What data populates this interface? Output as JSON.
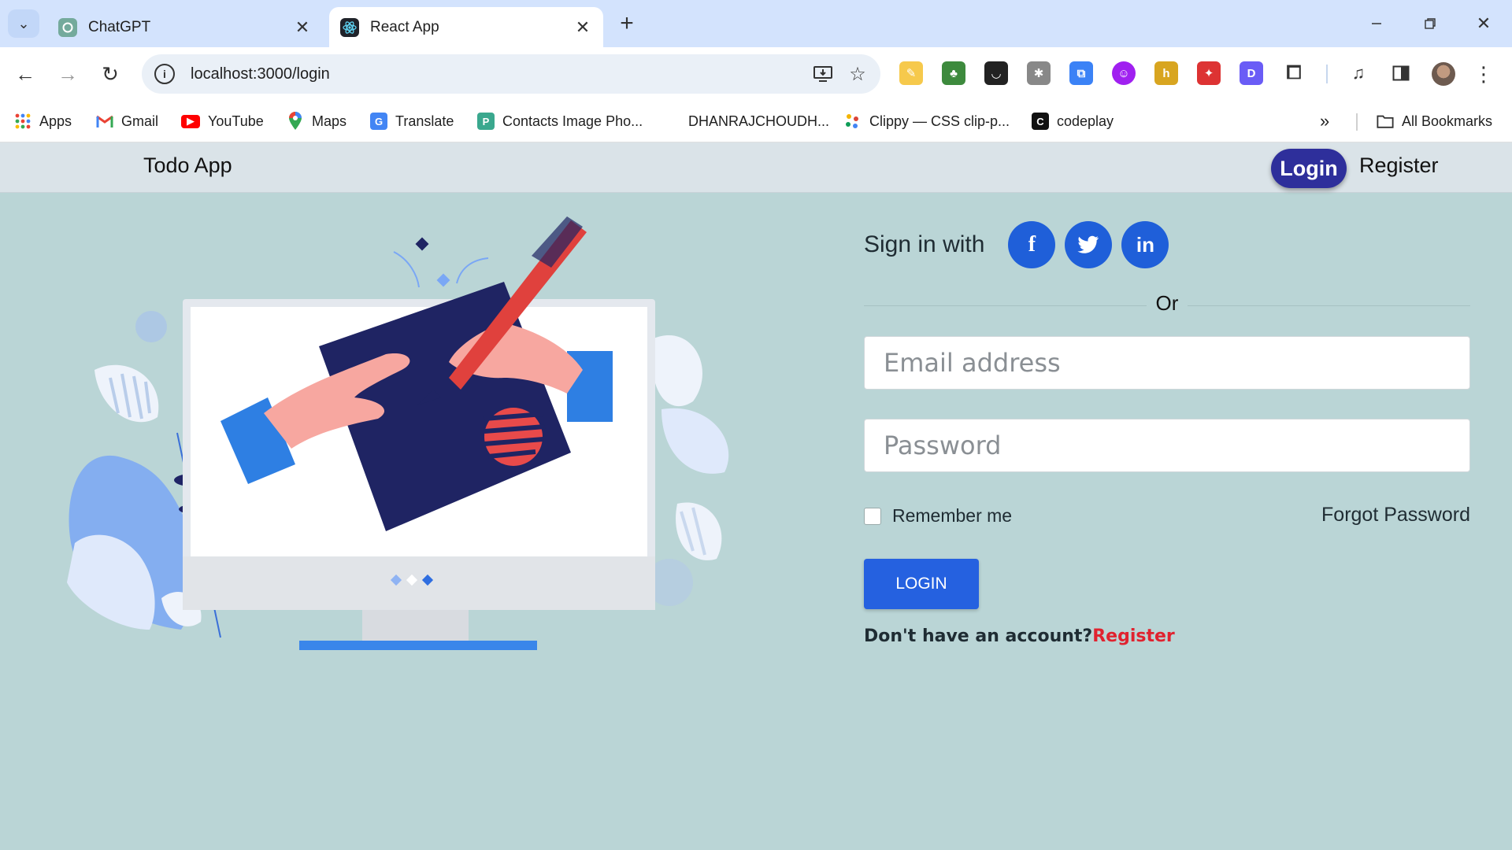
{
  "browser": {
    "tabs": [
      {
        "title": "ChatGPT",
        "active": false
      },
      {
        "title": "React App",
        "active": true
      }
    ],
    "url": "localhost:3000/login",
    "bookmarks": [
      {
        "label": "Apps",
        "icon": "apps-grid-icon"
      },
      {
        "label": "Gmail",
        "icon": "gmail-icon"
      },
      {
        "label": "YouTube",
        "icon": "youtube-icon"
      },
      {
        "label": "Maps",
        "icon": "maps-icon"
      },
      {
        "label": "Translate",
        "icon": "translate-icon"
      },
      {
        "label": "Contacts Image Pho...",
        "icon": "contacts-image-icon"
      },
      {
        "label": "DHANRAJCHOUDH...",
        "icon": "none"
      },
      {
        "label": "Clippy — CSS clip-p...",
        "icon": "clippy-icon"
      },
      {
        "label": "codeplay",
        "icon": "codeplay-icon"
      }
    ],
    "all_bookmarks_label": "All Bookmarks"
  },
  "app": {
    "brand": "Todo App",
    "nav": {
      "login": "Login",
      "register": "Register"
    },
    "form": {
      "signin_text": "Sign in with",
      "social": [
        "facebook",
        "twitter",
        "linkedin"
      ],
      "or_text": "Or",
      "email_placeholder": "Email address",
      "password_placeholder": "Password",
      "remember_label": "Remember me",
      "forgot_label": "Forgot Password",
      "login_button": "LOGIN",
      "no_account_text": "Don't have an account?",
      "register_link": "Register"
    }
  },
  "colors": {
    "page_bg": "#bad5d6",
    "navbar_bg": "#dae3e8",
    "nav_login_bg": "#2e2f9b",
    "primary_button": "#2561e0",
    "social_button": "#1f5fd9",
    "register_link": "#e0222f"
  }
}
